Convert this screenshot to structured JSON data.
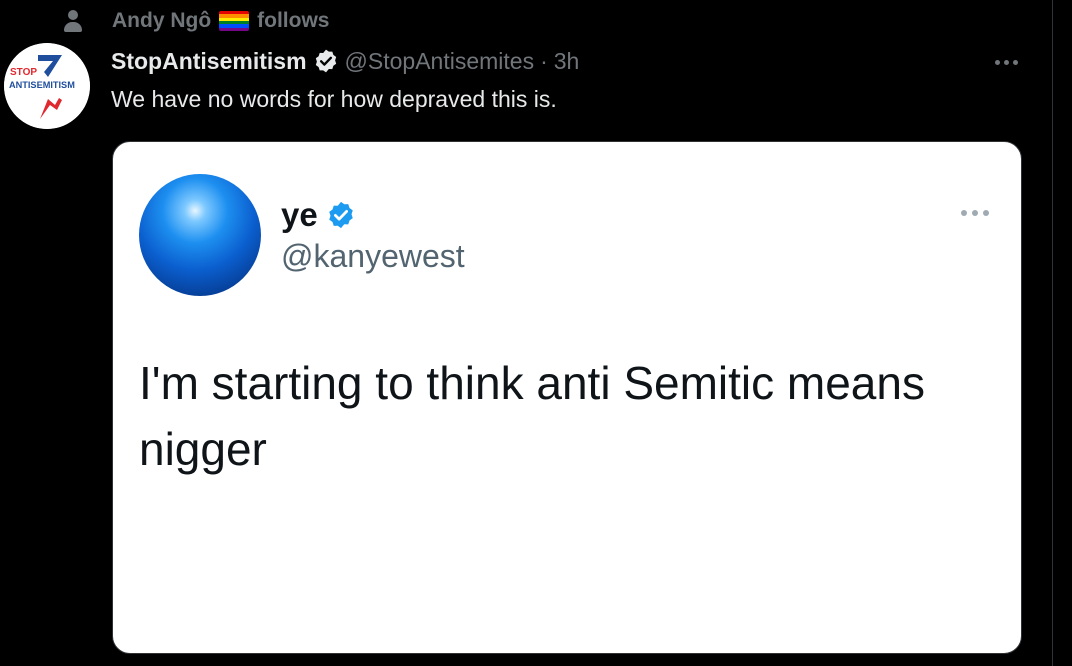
{
  "context": {
    "name": "Andy Ngô",
    "label": "follows",
    "icon": "person-icon",
    "flag_colors": [
      "#e40303",
      "#ff8c00",
      "#ffed00",
      "#008026",
      "#004dff",
      "#750787"
    ]
  },
  "tweet": {
    "display_name": "StopAntisemitism",
    "handle": "@StopAntisemites",
    "separator": "·",
    "time": "3h",
    "text": "We have no words for how depraved this is.",
    "avatar_logo": {
      "line1": "STOP",
      "line2": "ANTISEMITISM",
      "blue": "#1f4e9d",
      "red": "#e0282f"
    }
  },
  "quoted": {
    "display_name": "ye",
    "handle": "@kanyewest",
    "text": "I'm starting to think anti Semitic means nigger"
  },
  "colors": {
    "background": "#000000",
    "text_primary": "#e7e9ea",
    "text_secondary": "#71767b",
    "verified_blue": "#1d9bf0",
    "card_bg": "#ffffff"
  }
}
